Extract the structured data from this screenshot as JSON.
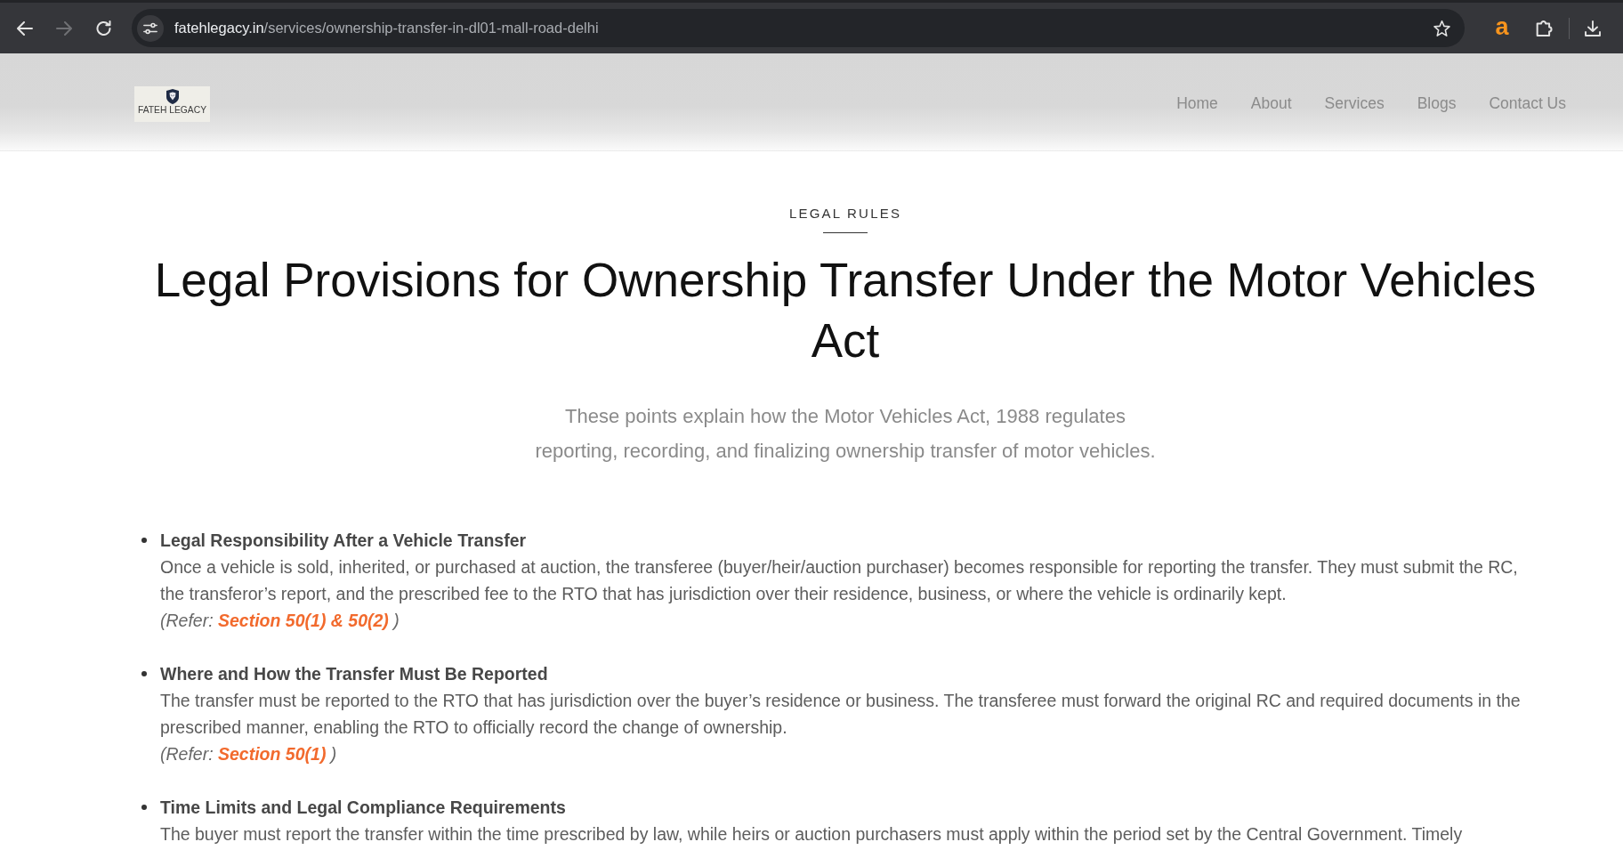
{
  "browser": {
    "nav_buttons": [
      {
        "kind": "back",
        "disabled": false
      },
      {
        "kind": "forward",
        "disabled": true
      },
      {
        "kind": "reload",
        "disabled": false
      }
    ],
    "address": {
      "domain": "fatehlegacy.in",
      "path": "/services/ownership-transfer-in-dl01-mall-road-delhi"
    },
    "extension_letter": "a"
  },
  "header": {
    "logo": {
      "name": "FATEH LEGACY"
    },
    "nav": [
      "Home",
      "About",
      "Services",
      "Blogs",
      "Contact Us"
    ]
  },
  "section": {
    "eyebrow": "LEGAL RULES",
    "title": "Legal Provisions for Ownership Transfer Under the Motor Vehicles Act",
    "intro": "These points explain how the Motor Vehicles Act, 1988 regulates reporting, recording, and finalizing ownership transfer of motor vehicles.",
    "points": [
      {
        "heading": "Legal Responsibility After a Vehicle Transfer",
        "body": "Once a vehicle is sold, inherited, or purchased at auction, the transferee (buyer/heir/auction purchaser) becomes responsible for reporting the transfer. They must submit the RC, the transferor’s report, and the prescribed fee to the RTO that has jurisdiction over their residence, business, or where the vehicle is ordinarily kept.",
        "reference": "(Refer: **Section 50(1) & 50(2)** )"
      },
      {
        "heading": "Where and How the Transfer Must Be Reported",
        "body": "The transfer must be reported to the RTO that has jurisdiction over the buyer’s residence or business. The transferee must forward the original RC and required documents in the prescribed manner, enabling the RTO to officially record the change of ownership.",
        "reference": "(Refer: **Section 50(1)** )"
      },
      {
        "heading": "Time Limits and Legal Compliance Requirements",
        "body": "The buyer must report the transfer within the time prescribed by law, while heirs or auction purchasers must apply within the period set by the Central Government. Timely"
      }
    ]
  }
}
